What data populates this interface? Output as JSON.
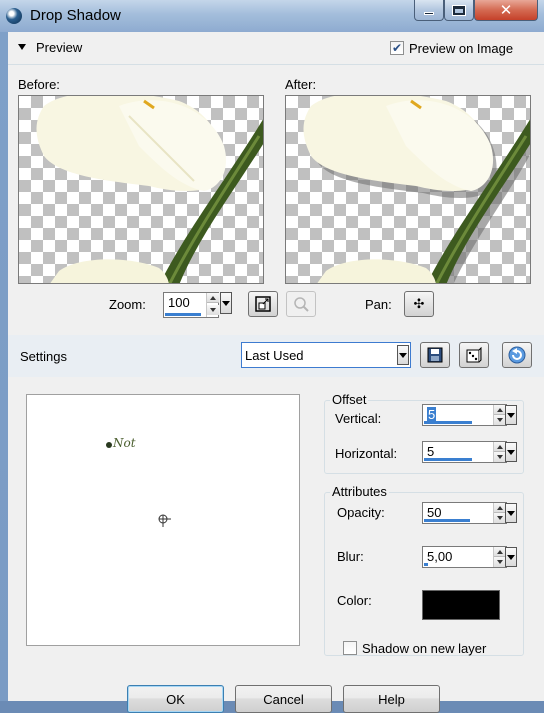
{
  "window": {
    "title": "Drop Shadow"
  },
  "preview": {
    "header_label": "Preview",
    "preview_on_image_label": "Preview on Image",
    "preview_on_image_checked": true,
    "before_label": "Before:",
    "after_label": "After:"
  },
  "zoom": {
    "label": "Zoom:",
    "value": "100",
    "pan_label": "Pan:"
  },
  "settings": {
    "label": "Settings",
    "preset": "Last Used"
  },
  "offset": {
    "title": "Offset",
    "vertical_label": "Vertical:",
    "vertical_value": "5",
    "horizontal_label": "Horizontal:",
    "horizontal_value": "5"
  },
  "attributes": {
    "title": "Attributes",
    "opacity_label": "Opacity:",
    "opacity_value": "50",
    "blur_label": "Blur:",
    "blur_value": "5,00",
    "color_label": "Color:",
    "color": "#000000"
  },
  "shadow_on_new_layer": {
    "label": "Shadow on new layer",
    "checked": false
  },
  "buttons": {
    "ok": "OK",
    "cancel": "Cancel",
    "help": "Help"
  },
  "canvas": {
    "watermark": "Not"
  }
}
